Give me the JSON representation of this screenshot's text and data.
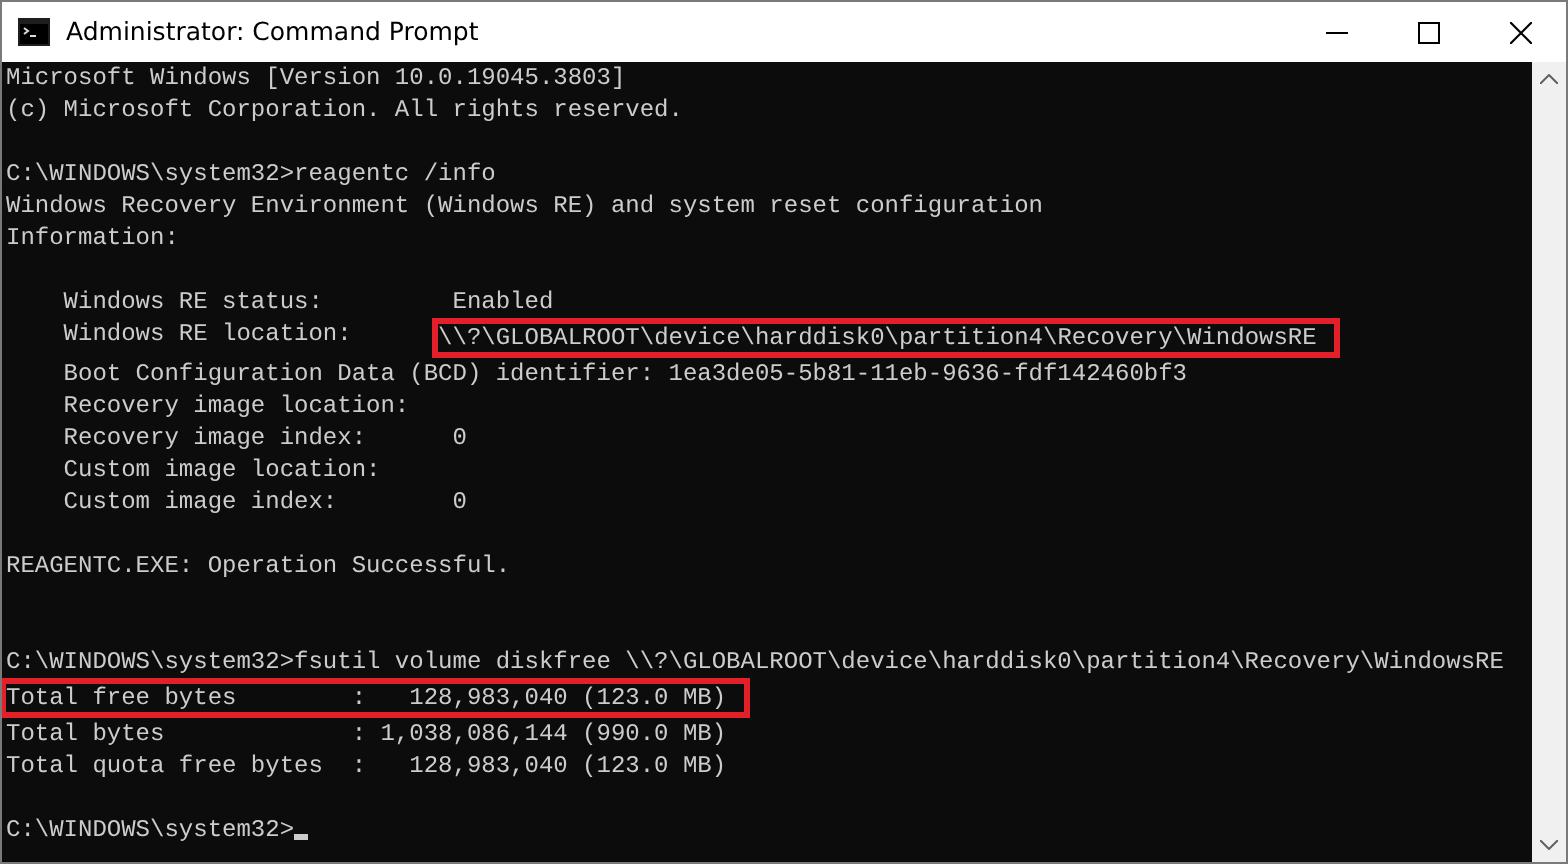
{
  "window": {
    "title": "Administrator: Command Prompt"
  },
  "console": {
    "lines": [
      {
        "kind": "text",
        "segments": [
          {
            "text": "Microsoft Windows [Version 10.0.19045.3803]",
            "highlighted": false
          }
        ]
      },
      {
        "kind": "text",
        "segments": [
          {
            "text": "(c) Microsoft Corporation. All rights reserved.",
            "highlighted": false
          }
        ]
      },
      {
        "kind": "blank"
      },
      {
        "kind": "text",
        "segments": [
          {
            "text": "C:\\WINDOWS\\system32>reagentc /info",
            "highlighted": false
          }
        ]
      },
      {
        "kind": "text",
        "segments": [
          {
            "text": "Windows Recovery Environment (Windows RE) and system reset configuration",
            "highlighted": false
          }
        ]
      },
      {
        "kind": "text",
        "segments": [
          {
            "text": "Information:",
            "highlighted": false
          }
        ]
      },
      {
        "kind": "blank"
      },
      {
        "kind": "text",
        "segments": [
          {
            "text": "    Windows RE status:         Enabled",
            "highlighted": false
          }
        ]
      },
      {
        "kind": "text",
        "segments": [
          {
            "text": "    Windows RE location:      ",
            "highlighted": false
          },
          {
            "text": "\\\\?\\GLOBALROOT\\device\\harddisk0\\partition4\\Recovery\\WindowsRE",
            "highlighted": true
          }
        ]
      },
      {
        "kind": "text",
        "segments": [
          {
            "text": "    Boot Configuration Data (BCD) identifier: 1ea3de05-5b81-11eb-9636-fdf142460bf3",
            "highlighted": false
          }
        ]
      },
      {
        "kind": "text",
        "segments": [
          {
            "text": "    Recovery image location:",
            "highlighted": false
          }
        ]
      },
      {
        "kind": "text",
        "segments": [
          {
            "text": "    Recovery image index:      0",
            "highlighted": false
          }
        ]
      },
      {
        "kind": "text",
        "segments": [
          {
            "text": "    Custom image location:",
            "highlighted": false
          }
        ]
      },
      {
        "kind": "text",
        "segments": [
          {
            "text": "    Custom image index:        0",
            "highlighted": false
          }
        ]
      },
      {
        "kind": "blank"
      },
      {
        "kind": "text",
        "segments": [
          {
            "text": "REAGENTC.EXE: Operation Successful.",
            "highlighted": false
          }
        ]
      },
      {
        "kind": "blank"
      },
      {
        "kind": "blank"
      },
      {
        "kind": "text",
        "segments": [
          {
            "text": "C:\\WINDOWS\\system32>fsutil volume diskfree \\\\?\\GLOBALROOT\\device\\harddisk0\\partition4\\Recovery\\WindowsRE",
            "highlighted": false
          }
        ]
      },
      {
        "kind": "text",
        "segments": [
          {
            "text": "Total free bytes        :   128,983,040 (123.0 MB)",
            "highlighted": true
          }
        ]
      },
      {
        "kind": "text",
        "segments": [
          {
            "text": "Total bytes             : 1,038,086,144 (990.0 MB)",
            "highlighted": false
          }
        ]
      },
      {
        "kind": "text",
        "segments": [
          {
            "text": "Total quota free bytes  :   128,983,040 (123.0 MB)",
            "highlighted": false
          }
        ]
      },
      {
        "kind": "blank"
      },
      {
        "kind": "prompt",
        "segments": [
          {
            "text": "C:\\WINDOWS\\system32>",
            "highlighted": false
          }
        ],
        "cursor": true
      }
    ]
  }
}
